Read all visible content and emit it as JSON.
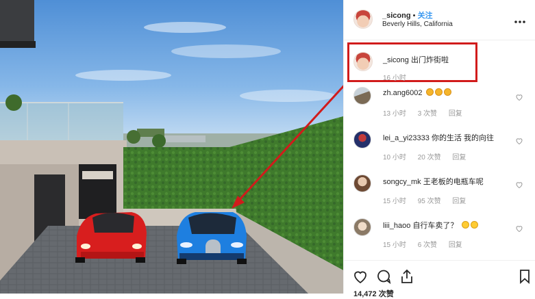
{
  "post": {
    "username": "_sicong",
    "separator": "•",
    "follow_label": "关注",
    "location": "Beverly Hills, California"
  },
  "caption": {
    "username": "_sicong",
    "text": "出门炸街啦",
    "time": "16 小时"
  },
  "comments": [
    {
      "username": "zh.ang6002",
      "text": "",
      "emoji": "clap",
      "emoji_count": 3,
      "time": "13 小时",
      "likes": "3 次赞",
      "reply": "回复"
    },
    {
      "username": "lei_a_yi23333",
      "text": "你的生活 我的向往",
      "emoji": "",
      "emoji_count": 0,
      "time": "10 小时",
      "likes": "20 次赞",
      "reply": "回复"
    },
    {
      "username": "songcy_mk",
      "text": "王老板的电瓶车呢",
      "emoji": "",
      "emoji_count": 0,
      "time": "15 小时",
      "likes": "95 次赞",
      "reply": "回复"
    },
    {
      "username": "liii_haoo",
      "text": "自行车卖了？",
      "emoji": "laugh",
      "emoji_count": 2,
      "time": "15 小时",
      "likes": "6 次赞",
      "reply": "回复"
    }
  ],
  "likes_total": "14,472 次赞",
  "icons": {
    "more": "more-icon",
    "like": "heart-icon",
    "comment": "comment-icon",
    "share": "share-icon",
    "save": "bookmark-icon"
  },
  "colors": {
    "follow_blue": "#3897f0",
    "annotation_red": "#d11b1b",
    "ferrari_red": "#d81e1e",
    "bugatti_blue": "#1e7fe0"
  }
}
